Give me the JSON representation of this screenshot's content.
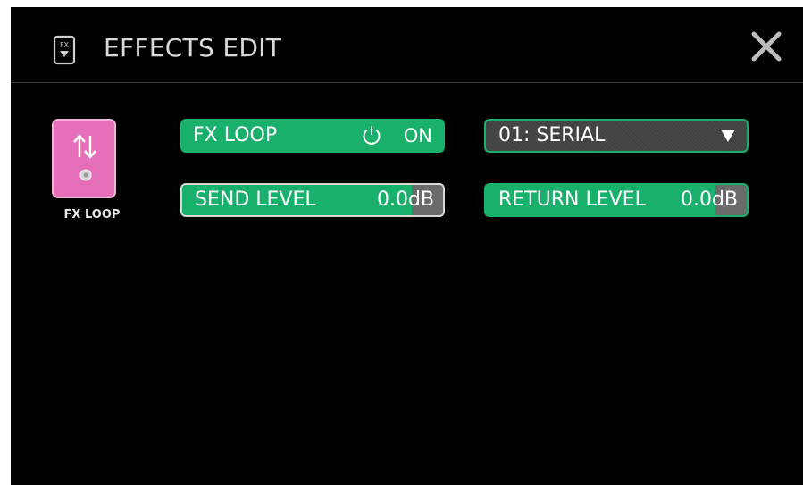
{
  "header": {
    "icon_label": "FX",
    "title": "EFFECTS EDIT",
    "close_icon": "close-icon"
  },
  "pedal": {
    "icon": "up-down-arrows-icon",
    "label": "FX LOOP",
    "color": "#e56fb8"
  },
  "fx_loop": {
    "label": "FX LOOP",
    "power_icon": "power-icon",
    "state": "ON"
  },
  "mode": {
    "selected": "01: SERIAL",
    "arrow_icon": "dropdown-triangle-icon"
  },
  "send_level": {
    "label": "SEND LEVEL",
    "value": "0.0dB"
  },
  "return_level": {
    "label": "RETURN LEVEL",
    "value": "0.0dB"
  },
  "colors": {
    "accent": "#18b06b",
    "background": "#000000",
    "pedal": "#e56fb8"
  }
}
